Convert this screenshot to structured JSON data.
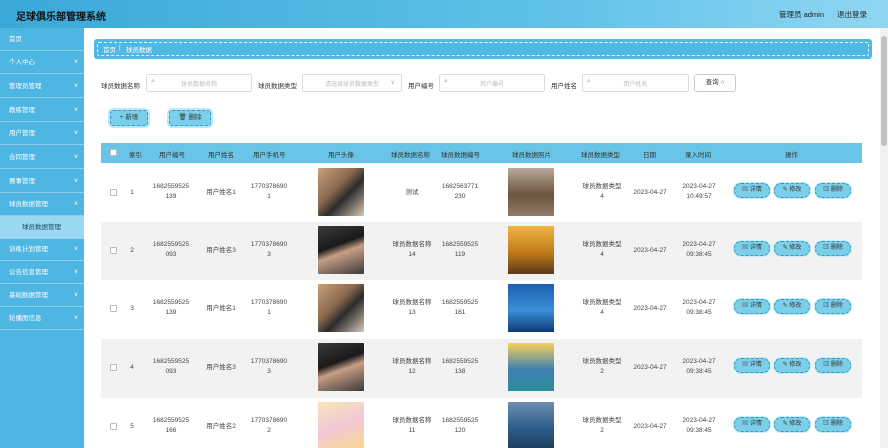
{
  "app": {
    "title": "足球俱乐部管理系统",
    "admin": "管理员 admin",
    "logout": "退出登录"
  },
  "sidebar": {
    "items": [
      "首页",
      "个人中心",
      "管理员管理",
      "教练管理",
      "用户管理",
      "合同管理",
      "赛事管理",
      "球员数据管理"
    ],
    "sub_item": "球员数据管理",
    "items2": [
      "训练计划管理",
      "公告信息管理",
      "基础数据管理",
      "轮播图信息"
    ]
  },
  "breadcrumb": {
    "home": "首页",
    "sep": "|",
    "current": "球员数据"
  },
  "filters": {
    "name_label": "球员数据名称",
    "name_ph": "球员数据名称",
    "type_label": "球员数据类型",
    "type_ph": "请选择球员数据类型",
    "uno_label": "用户编号",
    "uno_ph": "用户编号",
    "uname_label": "用户姓名",
    "uname_ph": "用户姓名",
    "query": "查询"
  },
  "actions": {
    "add": "新增",
    "delete": "删除"
  },
  "table": {
    "headers": [
      "索引",
      "用户编号",
      "用户姓名",
      "用户手机号",
      "用户头像",
      "球员数据名称",
      "球员数据编号",
      "球员数据照片",
      "球员数据类型",
      "日期",
      "录入时间",
      "操作"
    ],
    "rows": [
      {
        "index": "1",
        "uno": [
          "1682559525",
          "139"
        ],
        "uname": "用户姓名1",
        "phone": [
          "1770378690",
          "1"
        ],
        "dname": [
          "测试",
          ""
        ],
        "dno": [
          "1682563771",
          "230"
        ],
        "dtype": [
          "球员数据类型",
          "4"
        ],
        "date": "2023-04-27",
        "time": [
          "2023-04-27",
          "10:49:57"
        ]
      },
      {
        "index": "2",
        "uno": [
          "1682559525",
          "093"
        ],
        "uname": "用户姓名3",
        "phone": [
          "1770378690",
          "3"
        ],
        "dname": [
          "球员数据名称",
          "14"
        ],
        "dno": [
          "1682559525",
          "119"
        ],
        "dtype": [
          "球员数据类型",
          "4"
        ],
        "date": "2023-04-27",
        "time": [
          "2023-04-27",
          "09:38:45"
        ]
      },
      {
        "index": "3",
        "uno": [
          "1682559525",
          "139"
        ],
        "uname": "用户姓名1",
        "phone": [
          "1770378690",
          "1"
        ],
        "dname": [
          "球员数据名称",
          "13"
        ],
        "dno": [
          "1682559525",
          "161"
        ],
        "dtype": [
          "球员数据类型",
          "4"
        ],
        "date": "2023-04-27",
        "time": [
          "2023-04-27",
          "09:38:45"
        ]
      },
      {
        "index": "4",
        "uno": [
          "1682559525",
          "093"
        ],
        "uname": "用户姓名3",
        "phone": [
          "1770378690",
          "3"
        ],
        "dname": [
          "球员数据名称",
          "12"
        ],
        "dno": [
          "1682559525",
          "138"
        ],
        "dtype": [
          "球员数据类型",
          "2"
        ],
        "date": "2023-04-27",
        "time": [
          "2023-04-27",
          "09:38:45"
        ]
      },
      {
        "index": "5",
        "uno": [
          "1682559525",
          "166"
        ],
        "uname": "用户姓名2",
        "phone": [
          "1770378690",
          "2"
        ],
        "dname": [
          "球员数据名称",
          "11"
        ],
        "dno": [
          "1682559525",
          "120"
        ],
        "dtype": [
          "球员数据类型",
          "2"
        ],
        "date": "2023-04-27",
        "time": [
          "2023-04-27",
          "09:38:45"
        ]
      }
    ],
    "row_buttons": {
      "detail": "详情",
      "edit": "修改",
      "delete": "删除"
    }
  }
}
